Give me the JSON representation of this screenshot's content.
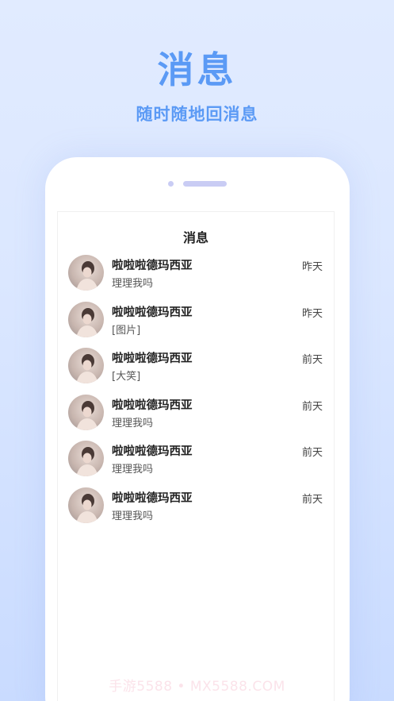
{
  "hero": {
    "title": "消息",
    "subtitle": "随时随地回消息"
  },
  "screen": {
    "title": "消息",
    "messages": [
      {
        "name": "啦啦啦德玛西亚",
        "preview": "理理我吗",
        "time": "昨天"
      },
      {
        "name": "啦啦啦德玛西亚",
        "preview": "[图片]",
        "time": "昨天"
      },
      {
        "name": "啦啦啦德玛西亚",
        "preview": "[大笑]",
        "time": "前天"
      },
      {
        "name": "啦啦啦德玛西亚",
        "preview": "理理我吗",
        "time": "前天"
      },
      {
        "name": "啦啦啦德玛西亚",
        "preview": "理理我吗",
        "time": "前天"
      },
      {
        "name": "啦啦啦德玛西亚",
        "preview": "理理我吗",
        "time": "前天"
      }
    ]
  },
  "watermark": "手游5588 • MX5588.COM",
  "colors": {
    "accent": "#5b9af5",
    "background": "#dbe7ff",
    "phone_detail": "#c9ccf4"
  }
}
